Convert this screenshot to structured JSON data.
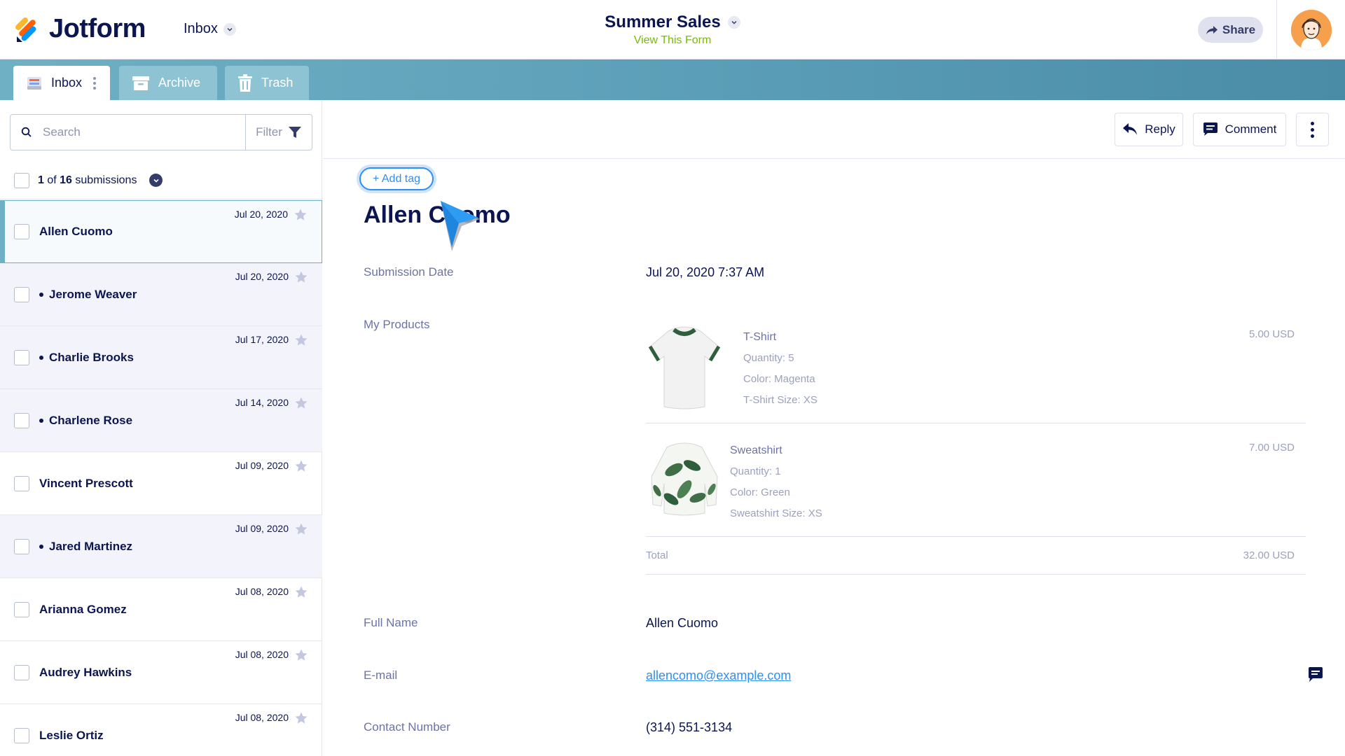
{
  "header": {
    "logo_text": "Jotform",
    "inbox_label": "Inbox",
    "form_title": "Summer Sales",
    "form_link": "View This Form",
    "share_label": "Share"
  },
  "tabs": [
    {
      "label": "Inbox"
    },
    {
      "label": "Archive"
    },
    {
      "label": "Trash"
    }
  ],
  "search": {
    "placeholder": "Search",
    "filter_label": "Filter"
  },
  "list_header": {
    "current": "1",
    "of_text": "of",
    "total": "16",
    "suffix": "submissions"
  },
  "submissions": [
    {
      "name": "Allen Cuomo",
      "date": "Jul 20, 2020"
    },
    {
      "name": "Jerome Weaver",
      "date": "Jul 20, 2020"
    },
    {
      "name": "Charlie Brooks",
      "date": "Jul 17, 2020"
    },
    {
      "name": "Charlene Rose",
      "date": "Jul 14, 2020"
    },
    {
      "name": "Vincent Prescott",
      "date": "Jul 09, 2020"
    },
    {
      "name": "Jared Martinez",
      "date": "Jul 09, 2020"
    },
    {
      "name": "Arianna Gomez",
      "date": "Jul 08, 2020"
    },
    {
      "name": "Audrey Hawkins",
      "date": "Jul 08, 2020"
    },
    {
      "name": "Leslie Ortiz",
      "date": "Jul 08, 2020"
    }
  ],
  "toolbar": {
    "reply_label": "Reply",
    "comment_label": "Comment"
  },
  "detail": {
    "add_tag_label": "+ Add tag",
    "name": "Allen Cuomo",
    "fields": {
      "submission_date_label": "Submission Date",
      "submission_date_value": "Jul 20, 2020 7:37 AM",
      "products_label": "My Products",
      "full_name_label": "Full Name",
      "full_name_value": "Allen Cuomo",
      "email_label": "E-mail",
      "email_value": "allencomo@example.com",
      "contact_label": "Contact Number",
      "contact_value": "(314) 551-3134"
    },
    "products": [
      {
        "name": "T-Shirt",
        "quantity": "Quantity: 5",
        "color": "Color: Magenta",
        "size": "T-Shirt Size: XS",
        "price": "5.00 USD"
      },
      {
        "name": "Sweatshirt",
        "quantity": "Quantity: 1",
        "color": "Color: Green",
        "size": "Sweatshirt Size: XS",
        "price": "7.00 USD"
      }
    ],
    "total_label": "Total",
    "total_value": "32.00 USD"
  },
  "colors": {
    "navy": "#0a1551",
    "accent_blue": "#2f8ef2",
    "tab_bar": "#5c9fb8",
    "link_green": "#78bb07"
  }
}
